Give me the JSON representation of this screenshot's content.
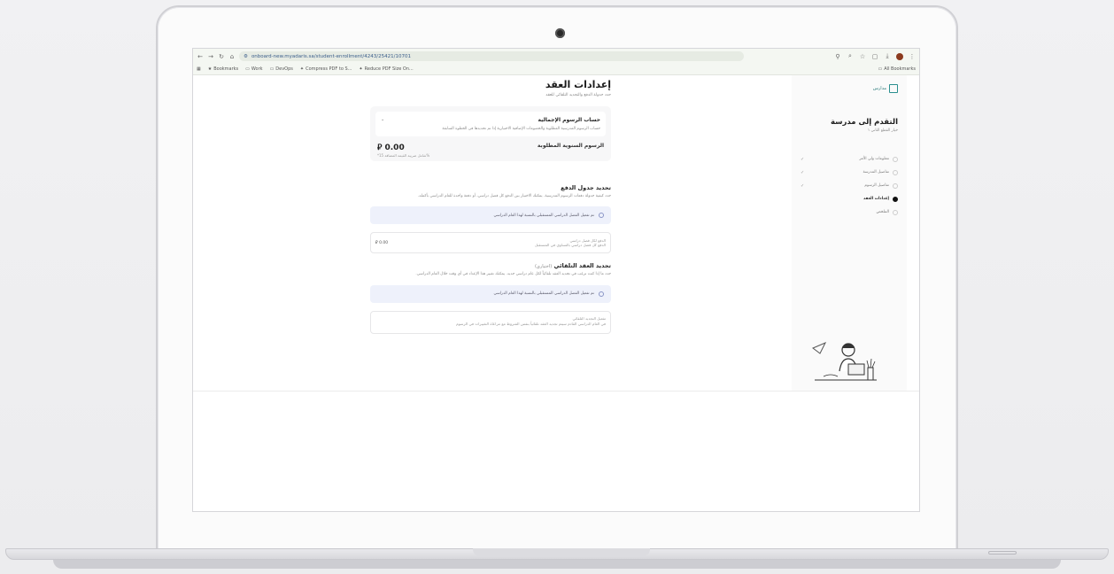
{
  "browser": {
    "url": "onboard-new.myadaris.sa/student-enrollment/4243/25421/10701",
    "bookmarks": [
      "Bookmarks",
      "Work",
      "DevOps",
      "Compress PDF to S...",
      "Reduce PDF Size On..."
    ],
    "all_bookmarks": "All Bookmarks"
  },
  "main": {
    "title": "إعدادات العقد",
    "subtitle": "حدد جدولة الدفع والتجديد التلقائي للعقد",
    "fees_card": {
      "title": "حساب الرسوم الإجمالية",
      "description": "حساب الرسوم المدرسية المطلوبة والخصومات الإضافية الاختيارية إذا تم تحديدها في الخطوة السابقة",
      "annual_label": "الرسوم السنوية المطلوبة",
      "annual_amount": "0.00",
      "currency_symbol": "⃁",
      "vat_note": "*شامل ضريبة القيمة المضافة 15%"
    },
    "payment_schedule": {
      "title": "تحديد جدول الدفع",
      "description": "حدد كيفية جدولة دفعات الرسوم المدرسية. يمكنك الاختيار بين الدفع كل فصل دراسي، أو دفعة واحدة للعام الدراسي بأكمله.",
      "info_text": "تم تفعيل الفصل الدراسي المستقبلي بالنسبة لهذا العام الدراسي",
      "option_title": "الدفع لكل فصل دراسي",
      "option_sub": "الدفع كل فصل دراسي بالتساوي في المستقبل",
      "option_value": "⃁ 0.00"
    },
    "auto_renew": {
      "title": "تجديد العقد التلقائي",
      "optional": "(اختياري)",
      "description": "حدد ما إذا كنت ترغب في تجديد العقد تلقائياً لكل عام دراسي جديد. يمكنك تغيير هذا الإعداد في أي وقت خلال العام الدراسي.",
      "info_text": "تم تفعيل الفصل الدراسي المستقبلي بالنسبة لهذا العام الدراسي",
      "option_title": "تفعيل التجديد التلقائي",
      "option_sub": "في العام الدراسي القادم سيتم تجديد العقد تلقائياً بنفس الشروط مع مراعاة التغييرات في الرسوم"
    }
  },
  "sidebar": {
    "logo_text": "مدارس",
    "title": "التقدم إلى مدرسة",
    "subtitle": "خيار القطع الثاني ١",
    "steps": [
      {
        "label": "معلومات ولي الأمر",
        "done": true
      },
      {
        "label": "تفاصيل المدرسة",
        "done": true
      },
      {
        "label": "تفاصيل الرسوم",
        "done": true
      },
      {
        "label": "إعدادات العقد",
        "done": false
      },
      {
        "label": "الملخص",
        "done": false
      }
    ],
    "check_mark": "✓"
  }
}
